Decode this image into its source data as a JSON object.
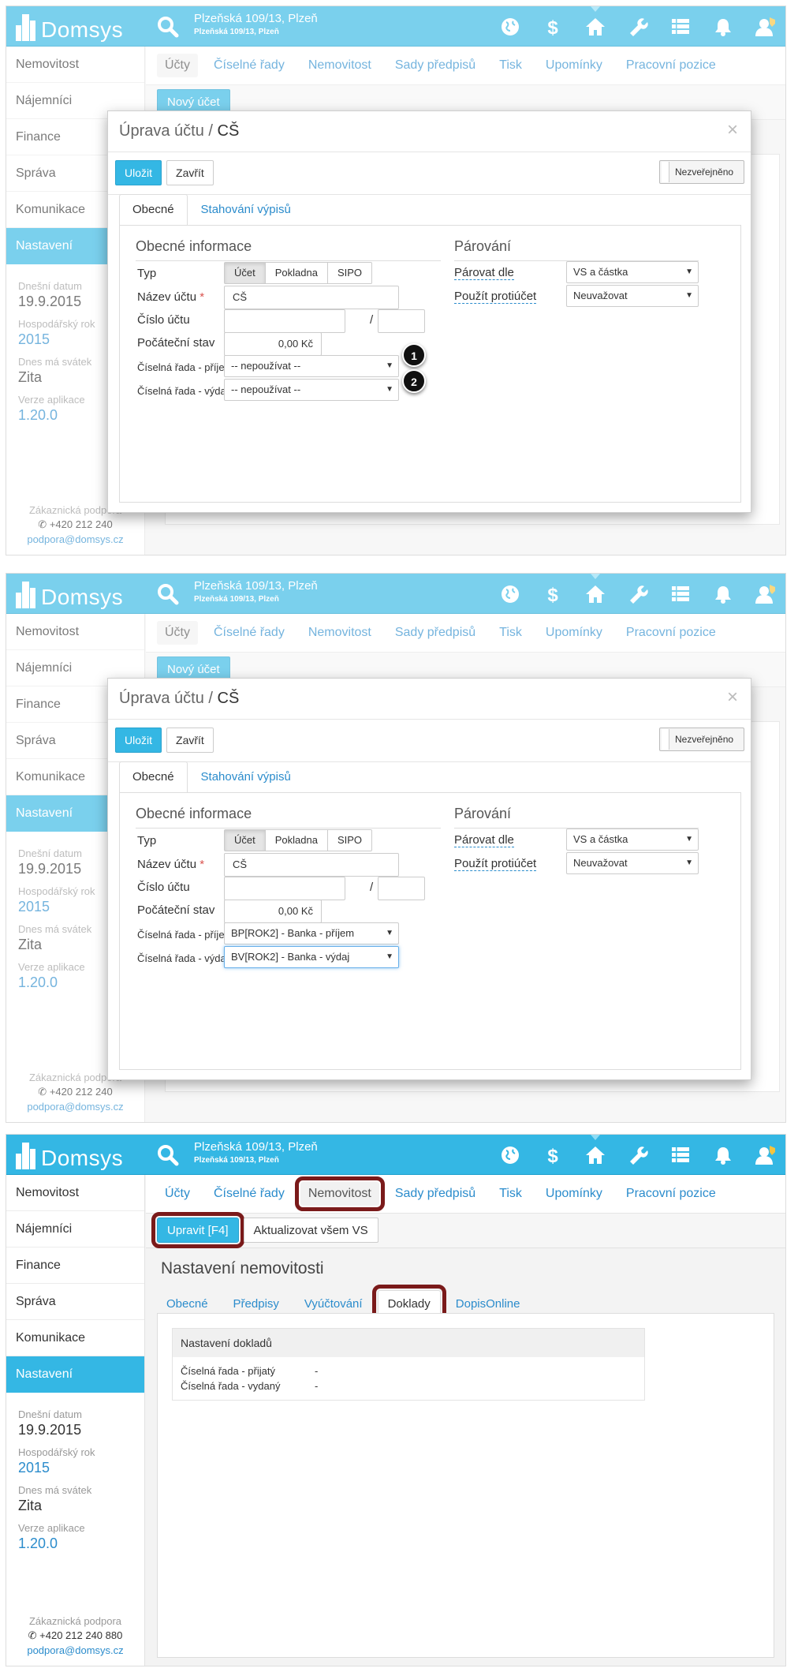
{
  "header": {
    "logo": "Domsys",
    "address_main": "Plzeňská 109/13, Plzeň",
    "address_sub": "Plzeňská 109/13, Plzeň",
    "icons": [
      "globe-icon",
      "dollar-icon",
      "home-icon",
      "wrench-icon",
      "list-icon",
      "bell-icon",
      "user-icon"
    ]
  },
  "sidebar": {
    "items": [
      "Nemovitost",
      "Nájemníci",
      "Finance",
      "Správa",
      "Komunikace",
      "Nastavení"
    ],
    "date_label": "Dnešní datum",
    "date_value": "19.9.2015",
    "year_label": "Hospodářský rok",
    "year_value": "2015",
    "nameday_label": "Dnes má svátek",
    "nameday_value": "Zita",
    "version_label": "Verze aplikace",
    "version_value": "1.20.0",
    "support_label": "Zákaznická podpora",
    "support_phone_short": "+420 212 240",
    "support_phone": "+420 212 240 880",
    "support_email": "podpora@domsys.cz"
  },
  "subnav": {
    "tabs": [
      "Účty",
      "Číselné řady",
      "Nemovitost",
      "Sady předpisů",
      "Tisk",
      "Upomínky",
      "Pracovní pozice"
    ]
  },
  "shot1": {
    "new_account_button": "Nový účet",
    "modal": {
      "title": "Úprava účtu / ",
      "title_bold": "CŠ",
      "close": "×",
      "save": "Uložit",
      "close_button": "Zavřít",
      "unpublished": "Nezveřejněno",
      "tabs": [
        "Obecné",
        "Stahování výpisů"
      ],
      "section_general": "Obecné informace",
      "section_pairing": "Párování",
      "type_label": "Typ",
      "type_options": [
        "Účet",
        "Pokladna",
        "SIPO"
      ],
      "name_label": "Název účtu",
      "required_mark": "*",
      "name_value": "CŠ",
      "number_label": "Číslo účtu",
      "number_sep": "/",
      "start_label": "Počáteční stav",
      "start_value": "0,00 Kč",
      "series_income_label": "Číselná řada - příjem",
      "series_expense_label": "Číselná řada - výdaj",
      "series_income_value": "-- nepoužívat --",
      "series_expense_value": "-- nepoužívat --",
      "pair_by_label": "Párovat dle",
      "pair_by_value": "VS a částka",
      "counter_label": "Použít protiúčet",
      "counter_value": "Neuvažovat",
      "badge1": "1",
      "badge2": "2"
    }
  },
  "shot2": {
    "series_income_value": "BP[ROK2] - Banka - příjem",
    "series_expense_value": "BV[ROK2] - Banka - výdaj"
  },
  "shot3": {
    "edit_button": "Upravit [F4]",
    "update_vs_button": "Aktualizovat všem VS",
    "page_title": "Nastavení nemovitosti",
    "tabs": [
      "Obecné",
      "Předpisy",
      "Vyúčtování",
      "Doklady",
      "DopisOnline"
    ],
    "table_title": "Nastavení dokladů",
    "rows": [
      {
        "key": "Číselná řada - přijatý",
        "value": "-"
      },
      {
        "key": "Číselná řada - vydaný",
        "value": "-"
      }
    ]
  },
  "colors": {
    "accent": "#34b7e4",
    "link": "#2b8ccc",
    "highlight_ring": "#7a1a1a"
  }
}
